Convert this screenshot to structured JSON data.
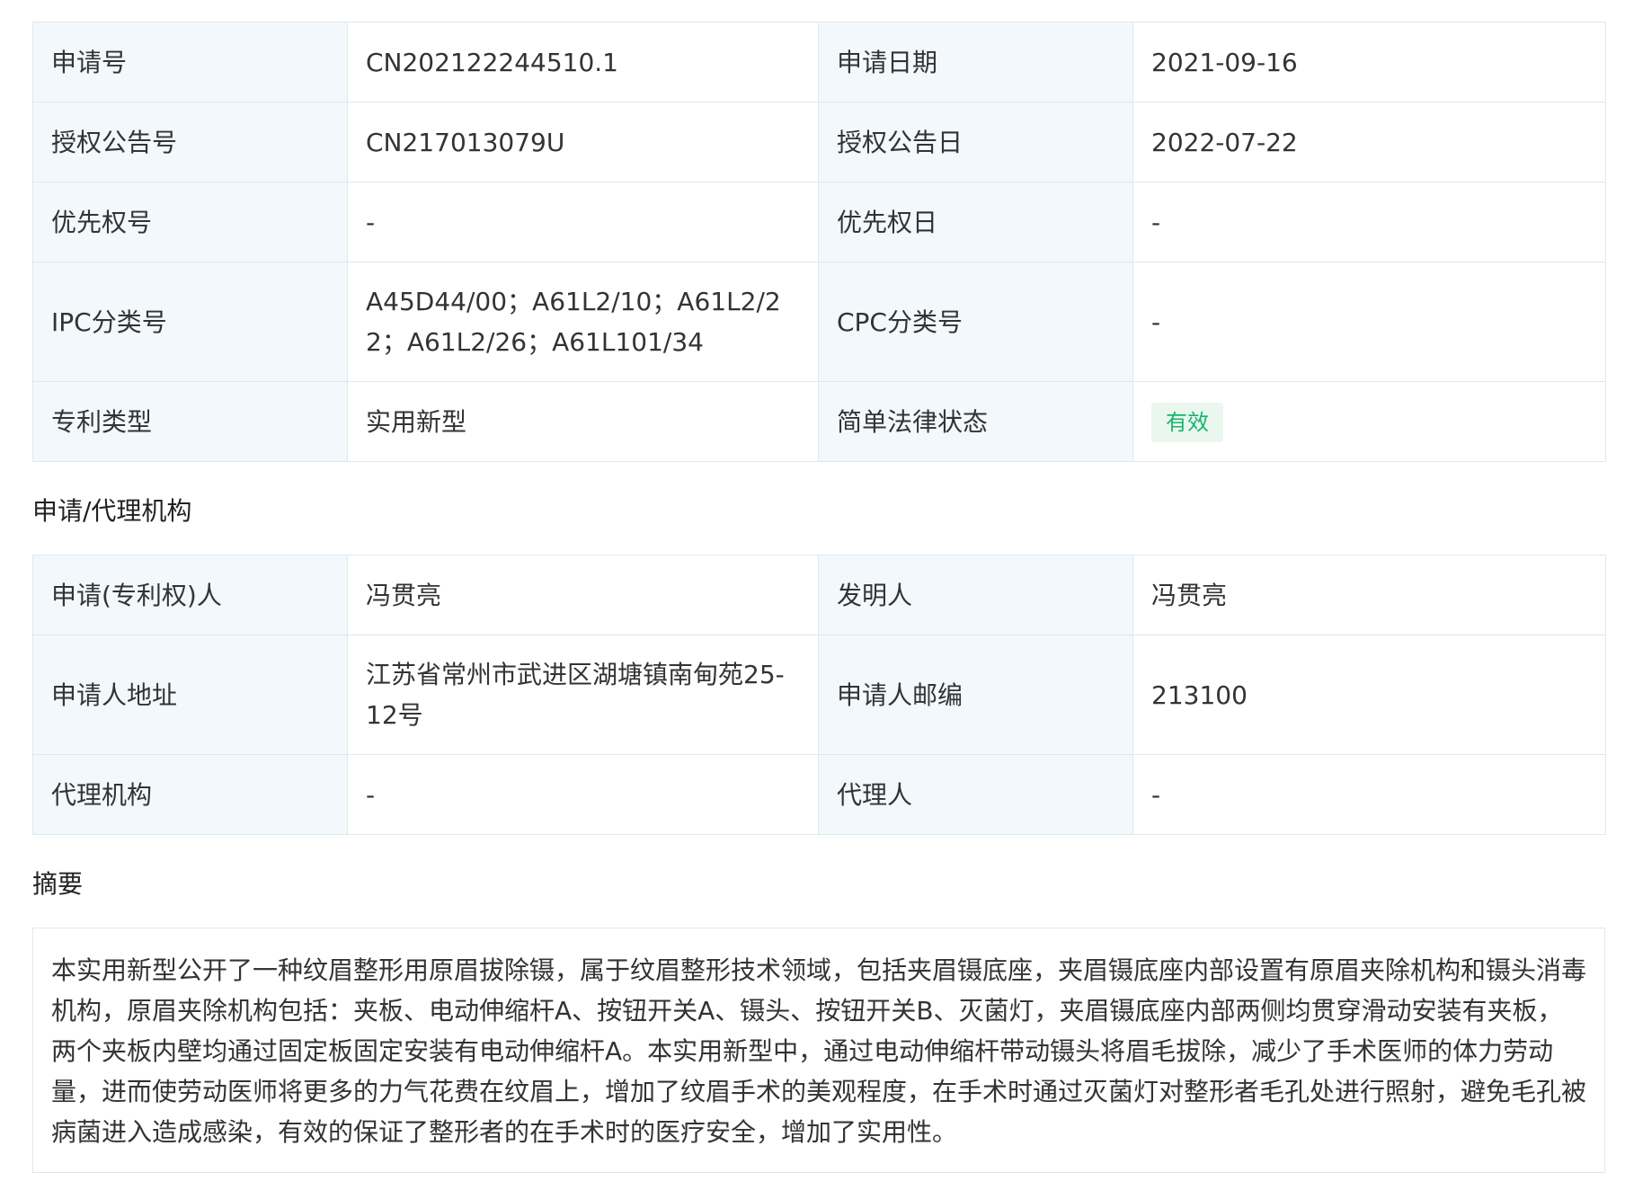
{
  "basic_info": {
    "rows": [
      {
        "l1": "申请号",
        "v1": "CN202122244510.1",
        "l2": "申请日期",
        "v2": "2021-09-16"
      },
      {
        "l1": "授权公告号",
        "v1": "CN217013079U",
        "l2": "授权公告日",
        "v2": "2022-07-22"
      },
      {
        "l1": "优先权号",
        "v1": "-",
        "l2": "优先权日",
        "v2": "-"
      },
      {
        "l1": "IPC分类号",
        "v1": "A45D44/00；A61L2/10；A61L2/22；A61L2/26；A61L101/34",
        "l2": "CPC分类号",
        "v2": "-"
      },
      {
        "l1": "专利类型",
        "v1": "实用新型",
        "l2": "简单法律状态",
        "v2": "有效"
      }
    ]
  },
  "status_badge_colors": {
    "text": "#19b46a",
    "background": "#e9f7ef"
  },
  "agency_section": {
    "title": "申请/代理机构",
    "rows": [
      {
        "l1": "申请(专利权)人",
        "v1": "冯贯亮",
        "l2": "发明人",
        "v2": "冯贯亮"
      },
      {
        "l1": "申请人地址",
        "v1": "江苏省常州市武进区湖塘镇南甸苑25-12号",
        "l2": "申请人邮编",
        "v2": "213100"
      },
      {
        "l1": "代理机构",
        "v1": "-",
        "l2": "代理人",
        "v2": "-"
      }
    ]
  },
  "abstract_section": {
    "title": "摘要",
    "text": "本实用新型公开了一种纹眉整形用原眉拔除镊，属于纹眉整形技术领域，包括夹眉镊底座，夹眉镊底座内部设置有原眉夹除机构和镊头消毒机构，原眉夹除机构包括：夹板、电动伸缩杆A、按钮开关A、镊头、按钮开关B、灭菌灯，夹眉镊底座内部两侧均贯穿滑动安装有夹板，两个夹板内壁均通过固定板固定安装有电动伸缩杆A。本实用新型中，通过电动伸缩杆带动镊头将眉毛拔除，减少了手术医师的体力劳动量，进而使劳动医师将更多的力气花费在纹眉上，增加了纹眉手术的美观程度，在手术时通过灭菌灯对整形者毛孔处进行照射，避免毛孔被病菌进入造成感染，有效的保证了整形者的在手术时的医疗安全，增加了实用性。"
  }
}
